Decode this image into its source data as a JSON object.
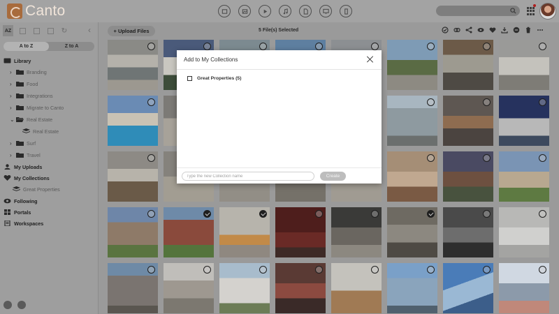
{
  "app": {
    "logo_text": "Canto"
  },
  "topbar": {
    "icons": [
      "album-icon",
      "image-icon",
      "video-icon",
      "audio-icon",
      "document-icon",
      "presentation-icon",
      "other-files-icon"
    ],
    "accent": "#a86b3c"
  },
  "sidebar": {
    "tools": [
      "AZ"
    ],
    "sort": {
      "a_to_z": "A to Z",
      "z_to_a": "Z to A"
    },
    "library": "Library",
    "folders": {
      "branding": "Branding",
      "food": "Food",
      "integrations": "Integrations",
      "migrate": "Migrate to Canto",
      "real_estate": "Real Estate",
      "real_estate_album": "Real Estate",
      "surf": "Surf",
      "travel": "Travel"
    },
    "my_uploads": "My Uploads",
    "my_collections": "My Collections",
    "great_properties": "Great Properties",
    "following": "Following",
    "portals": "Portals",
    "workspaces": "Workspaces"
  },
  "toolbar": {
    "upload_label": "Upload Files",
    "selected_text": "5    File(s) Selected",
    "actions": [
      "select-all-icon",
      "link-icon",
      "share-icon",
      "preview-icon",
      "favorite-icon",
      "download-icon",
      "remove-icon",
      "delete-icon",
      "more-icon"
    ]
  },
  "grid": {
    "tiles": [
      {
        "scene": "white kitchen with island and pendant lights",
        "selected": false
      },
      {
        "scene": "modern white house exterior at dusk",
        "selected": false
      },
      {
        "scene": "house exterior",
        "selected": false
      },
      {
        "scene": "mountain lake view",
        "selected": false
      },
      {
        "scene": "house exterior",
        "selected": false
      },
      {
        "scene": "palm tree lined pool courtyard",
        "selected": false
      },
      {
        "scene": "outdoor patio with wood ceiling",
        "selected": false
      },
      {
        "scene": "bright open kitchen",
        "selected": false
      },
      {
        "scene": "villa with swimming pool",
        "selected": false
      },
      {
        "scene": "interior",
        "selected": false
      },
      {
        "scene": "interior",
        "selected": false
      },
      {
        "scene": "interior",
        "selected": false
      },
      {
        "scene": "interior",
        "selected": false
      },
      {
        "scene": "modern glass apartment building",
        "selected": false
      },
      {
        "scene": "living room with fireplace",
        "selected": false
      },
      {
        "scene": "modern house at night",
        "selected": false
      },
      {
        "scene": "kitchen with wooden island",
        "selected": false
      },
      {
        "scene": "interior",
        "selected": false
      },
      {
        "scene": "interior",
        "selected": false
      },
      {
        "scene": "interior",
        "selected": false
      },
      {
        "scene": "interior",
        "selected": false
      },
      {
        "scene": "bright living room with windows",
        "selected": false
      },
      {
        "scene": "landscaped garden at dusk",
        "selected": false
      },
      {
        "scene": "suburban house with lawn",
        "selected": false
      },
      {
        "scene": "stone cottage",
        "selected": false
      },
      {
        "scene": "brick house with lawn",
        "selected": true
      },
      {
        "scene": "living room with orange sofa",
        "selected": true
      },
      {
        "scene": "dark red bathroom",
        "selected": false
      },
      {
        "scene": "dark bathroom with tub",
        "selected": false
      },
      {
        "scene": "modern kitchen with round window",
        "selected": true
      },
      {
        "scene": "dark modern kitchen",
        "selected": false
      },
      {
        "scene": "white kitchen",
        "selected": false
      },
      {
        "scene": "apartment building with balconies",
        "selected": false
      },
      {
        "scene": "corridor with glass railing",
        "selected": false
      },
      {
        "scene": "white apartment building",
        "selected": false
      },
      {
        "scene": "fire escape stairs",
        "selected": false
      },
      {
        "scene": "empty room with wooden floor",
        "selected": false
      },
      {
        "scene": "glass skyscraper",
        "selected": false
      },
      {
        "scene": "glass tower against blue sky",
        "selected": false
      },
      {
        "scene": "skyscraper facade",
        "selected": false
      }
    ]
  },
  "modal": {
    "title": "Add to My Collections",
    "collections": [
      {
        "label": "Great Properties (5)",
        "checked": false
      }
    ],
    "input_placeholder": "Type the new Collection name",
    "create_label": "Create"
  }
}
